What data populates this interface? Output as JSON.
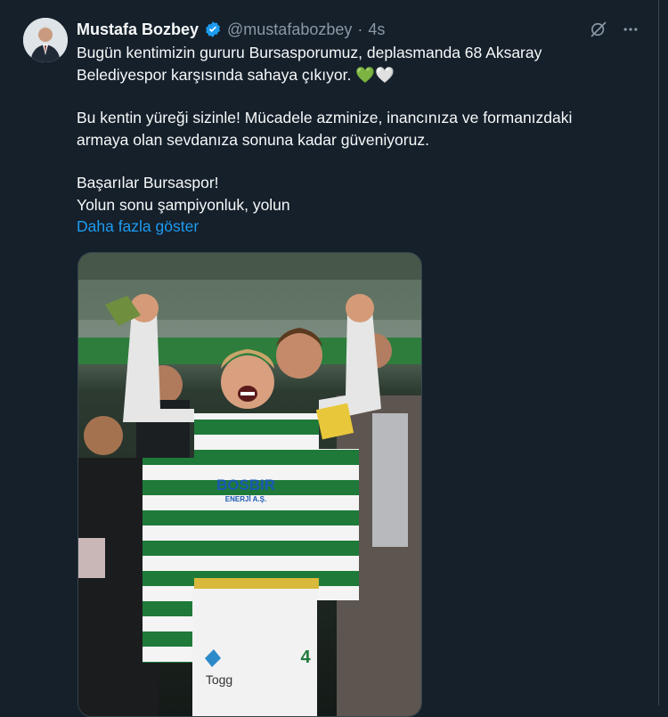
{
  "tweet": {
    "author_name": "Mustafa Bozbey",
    "handle": "@mustafabozbey",
    "separator": "·",
    "time": "4s",
    "verified": true,
    "lines": [
      "Bugün kentimizin gururu Bursasporumuz, deplasmanda 68 Aksaray",
      "Belediyespor karşısında sahaya çıkıyor. 💚🤍",
      "Bu kentin yüreği sizinle! Mücadele azminize, inancınıza ve formanızdaki",
      "armaya olan sevdanıza sonuna kadar güveniyoruz.",
      "Başarılar Bursaspor!",
      "Yolun sonu şampiyonluk, yolun"
    ],
    "show_more": "Daha fazla göster",
    "sponsor_text": "BOSBIR",
    "sponsor_subtext": "ENERJİ A.Ş.",
    "shorts_text": "Togg",
    "shorts_number": "4"
  },
  "colors": {
    "background": "#15202b",
    "text": "#f7f9f9",
    "secondary": "#8b98a5",
    "link": "#1d9bf0"
  },
  "icons": [
    "grok-icon",
    "more-options-icon",
    "verified-badge-icon"
  ]
}
